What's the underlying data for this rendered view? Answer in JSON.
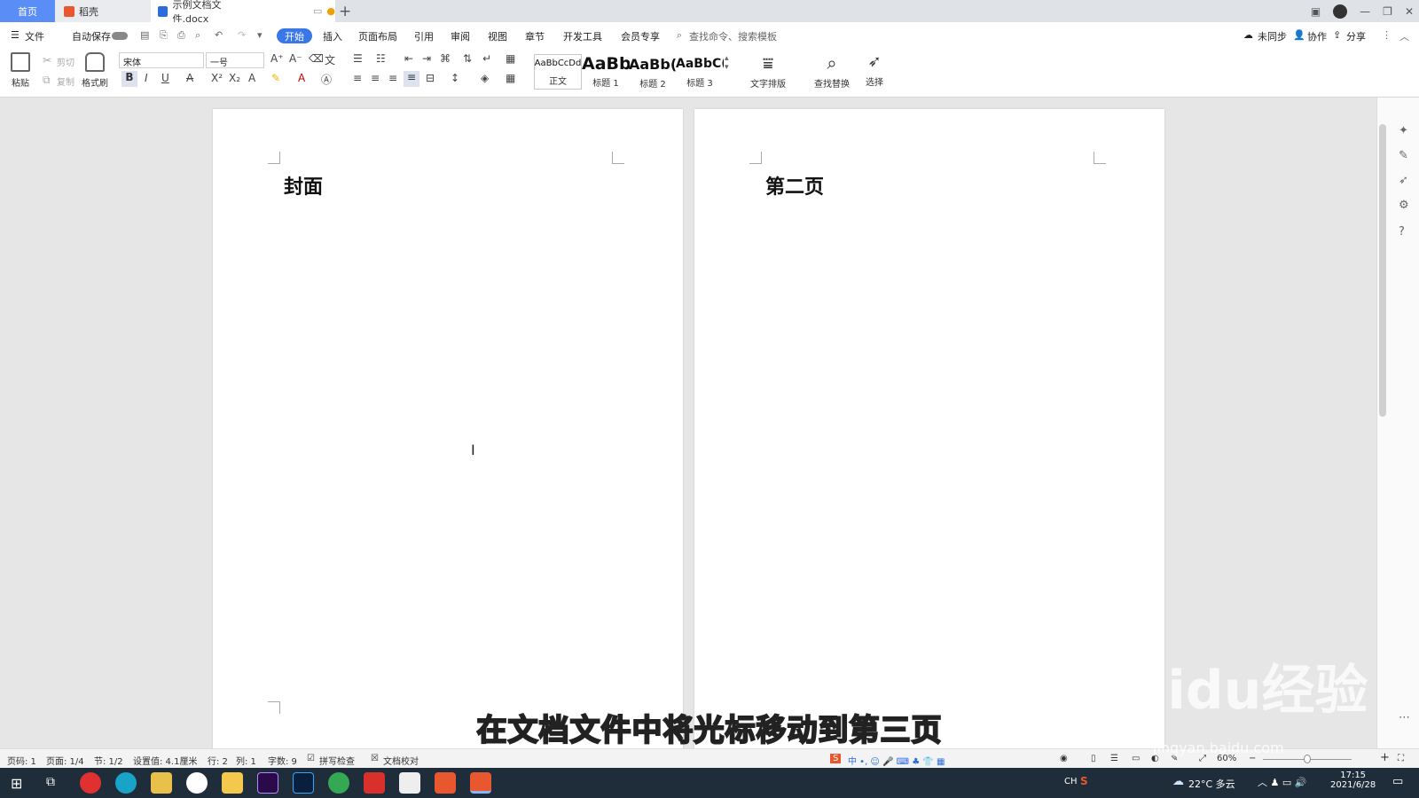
{
  "tabs": {
    "home": "首页",
    "daoke": "稻壳",
    "doc": "示例文档文件.docx"
  },
  "menu": {
    "file": "文件",
    "autosave": "自动保存",
    "start": "开始",
    "insert": "插入",
    "layout": "页面布局",
    "reference": "引用",
    "review": "审阅",
    "view": "视图",
    "chapter": "章节",
    "devtools": "开发工具",
    "member": "会员专享",
    "search_placeholder": "查找命令、搜索模板",
    "unsync": "未同步",
    "collab": "协作",
    "share": "分享"
  },
  "toolbar": {
    "paste": "粘贴",
    "cut": "剪切",
    "copy": "复制",
    "format_painter": "格式刷",
    "font": "宋体",
    "font_size": "一号",
    "styles": [
      {
        "sample": "AaBbCcDd",
        "label": "正文"
      },
      {
        "sample": "AaBb",
        "label": "标题 1"
      },
      {
        "sample": "AaBb(",
        "label": "标题 2"
      },
      {
        "sample": "AaBbC(",
        "label": "标题 3"
      }
    ],
    "text_layout": "文字排版",
    "find_replace": "查找替换",
    "select": "选择"
  },
  "pages": [
    {
      "text": "封面"
    },
    {
      "text": "第二页"
    }
  ],
  "status": {
    "page_code": "页码: 1",
    "page": "页面: 1/4",
    "section": "节: 1/2",
    "setting": "设置值: 4.1厘米",
    "row": "行: 2",
    "col": "列: 1",
    "words": "字数: 9",
    "spell": "拼写检查",
    "proof": "文档校对",
    "zoom": "60%"
  },
  "taskbar": {
    "lang": "CH",
    "weather": "22°C 多云",
    "time": "17:15",
    "date": "2021/6/28"
  },
  "overlay": {
    "subtitle": "在文档文件中将光标移动到第三页",
    "watermark": "Baidu经验",
    "watermark_url": "jingyan.baidu.com"
  }
}
